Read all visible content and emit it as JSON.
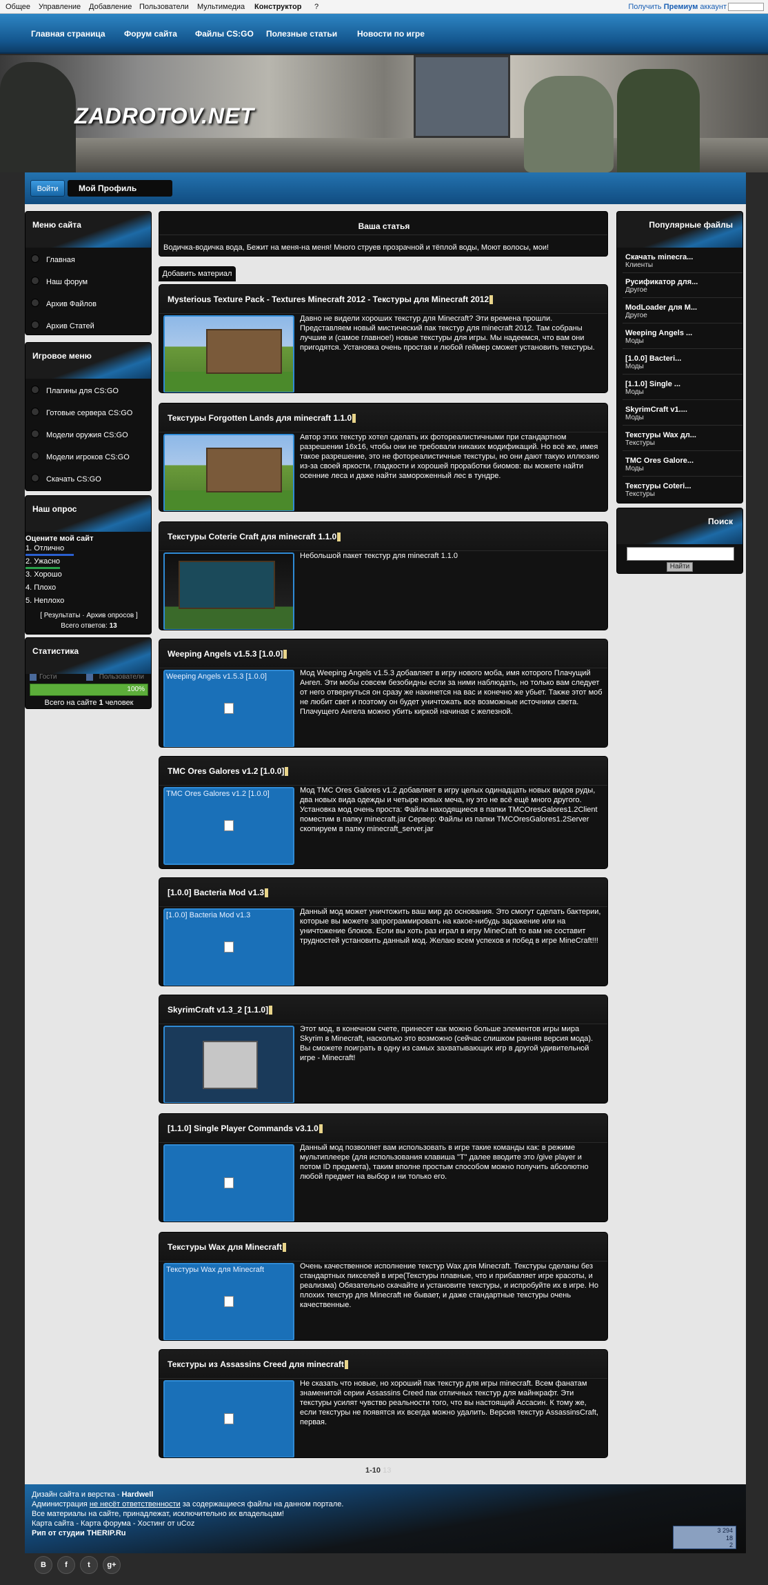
{
  "topbar": {
    "items": [
      "Общее",
      "Управление",
      "Добавление",
      "Пользователи",
      "Мультимедиа",
      "Конструктор",
      "?"
    ],
    "right_prefix": "Получить",
    "right_bold": "Премиум",
    "right_suffix": "аккаунт"
  },
  "nav": [
    "Главная страница",
    "Форум сайта",
    "Файлы CS:GO",
    "Полезные статьи",
    "Новости по игре"
  ],
  "header": {
    "logo": "ZADROTOV.NET"
  },
  "login": {
    "enter": "Войти",
    "profile": "Мой Профиль"
  },
  "left": {
    "site_menu": {
      "title": "Меню сайта",
      "items": [
        "Главная",
        "Наш форум",
        "Архив Файлов",
        "Архив Статей"
      ]
    },
    "game_menu": {
      "title": "Игровое меню",
      "items": [
        "Плагины для CS:GO",
        "Готовые сервера CS:GO",
        "Модели оружия CS:GO",
        "Модели игроков CS:GO",
        "Скачать CS:GO"
      ]
    },
    "poll": {
      "title": "Наш опрос",
      "question": "Оцените мой сайт",
      "options": [
        "1. Отлично",
        "2. Ужасно",
        "3. Хорошо",
        "4. Плохо",
        "5. Неплохо"
      ],
      "links": "[ Результаты · Архив опросов ]",
      "total_label": "Всего ответов:",
      "total": "13"
    },
    "stats": {
      "title": "Статистика",
      "col1": "Гости",
      "col2": "Пользователи",
      "percent": "100%",
      "online_prefix": "Всего на сайте",
      "online_count": "1",
      "online_suffix": "человек"
    }
  },
  "center": {
    "head_title": "Ваша статья",
    "head_text": "Водичка-водичка вода, Бежит на меня-на меня! Много струев прозрачной и тёплой воды, Моют волосы, мои!",
    "add_button": "Добавить материал",
    "articles": [
      {
        "title": "Mysterious Texture Pack - Textures Minecraft 2012 - Текстуры для Minecraft 2012",
        "alt": "",
        "text": "Давно не видели хороших текстур для Minecraft? Эти времена прошли. Представляем новый мистический пак текстур для minecraft 2012. Там собраны лучшие и (самое главное!) новые текстуры для игры. Мы надеемся, что вам они пригодятся. Установка очень простая и любой геймер сможет установить текстуры."
      },
      {
        "title": "Текстуры Forgotten Lands для minecraft 1.1.0",
        "alt": "",
        "text": "Автор этих текстур хотел сделать их фотореалистичными при стандартном разрешении 16х16, чтобы они не требовали никаких модификаций. Но всё же, имея такое разрешение, это не фотореалистичные текстуры, но они дают такую иллюзию из-за своей яркости, гладкости и хорошей проработки биомов: вы можете найти осенние леса и даже найти замороженный лес в тундре."
      },
      {
        "title": "Текстуры Coterie Craft для minecraft 1.1.0",
        "alt": "",
        "text": "Небольшой пакет текстур для minecraft 1.1.0"
      },
      {
        "title": "Weeping Angels v1.5.3 [1.0.0]",
        "alt": "Weeping Angels v1.5.3 [1.0.0]",
        "text": "Мод Weeping Angels v1.5.3 добавляет в игру нового моба, имя которого Плачущий Ангел. Эти мобы совсем безобидны если за ними наблюдать, но только вам следует от него отвернуться он сразу же накинется на вас и конечно же убьет. Также этот моб не любит свет и поэтому он будет уничтожать все возможные источники света. Плачущего Ангела можно убить киркой начиная с железной."
      },
      {
        "title": "TMC Ores Galores v1.2 [1.0.0]",
        "alt": "TMC Ores Galores v1.2 [1.0.0]",
        "text": "Мод TMC Ores Galores v1.2 добавляет в игру целых одинадцать новых видов руды, два новых вида одежды и четыре новых меча, ну это не всё ещё много другого. Установка мод очень проста: Файлы находящиеся в папки TMCOresGalores1.2Client поместим в папку minecraft.jar Сервер: Файлы из папки TMCOresGalores1.2Server скопируем в папку minecraft_server.jar"
      },
      {
        "title": "[1.0.0] Bacteria Mod v1.3",
        "alt": "[1.0.0] Bacteria Mod v1.3",
        "text": "Данный мод может уничтожить ваш мир до основания. Это смогут сделать бактерии, которые вы можете запрограммировать на какое-нибудь заражение или на уничтожение блоков. Если вы хоть раз играл в игру MineCraft то вам не составит трудностей установить данный мод. Желаю всем успехов и побед в игре MineCraft!!!"
      },
      {
        "title": "SkyrimCraft v1.3_2 [1.1.0]",
        "alt": "",
        "text": "Этот мод, в конечном счете, принесет как можно больше элементов игры мира Skyrim в Minecraft, насколько это возможно (сейчас слишком ранняя версия мода). Вы сможете поиграть в одну из самых захватывающих игр в другой удивительной игре - Minecraft!"
      },
      {
        "title": "[1.1.0] Single Player Commands v3.1.0",
        "alt": "",
        "text": "Данный мод позволяет вам использовать в игре такие команды как: в режиме мультиплеере (для использования клавиша \"T\" далее вводите это /give player и потом ID предмета), таким вполне простым способом можно получить абсолютно любой предмет на выбор и ни только его."
      },
      {
        "title": "Текстуры Wax для Minecraft",
        "alt": "Текстуры Wax для Minecraft",
        "text": "Очень качественное исполнение текстур Wax для Minecraft. Текстуры сделаны без стандартных пикселей в игре(Текстуры плавные, что и прибавляет игре красоты, и реализма) Обязательно скачайте и установите текстуры, и испробуйте их в игре. Но плохих текстур для Minecraft не бывает, и даже стандартные текстуры очень качественные."
      },
      {
        "title": "Текстуры из Assassins Creed для minecraft",
        "alt": "",
        "text": "Не сказать что новые, но хороший пак текстур для игры minecraft. Всем фанатам знаменитой серии Assassins Creed пак отличных текстур для майнкрафт. Эти текстуры усилят чувство реальности того, что вы настоящий Ассасин. К тому же, если текстуры не появятся их всегда можно удалить. Версия текстур AssassinsCraft, первая."
      }
    ],
    "pager": "1-10",
    "pager_rest": "13"
  },
  "right": {
    "popular": {
      "title": "Популярные файлы",
      "items": [
        {
          "t": "Скачать minecra...",
          "c": "Клиенты"
        },
        {
          "t": "Русификатор для...",
          "c": "Другое"
        },
        {
          "t": "ModLoader для M...",
          "c": "Другое"
        },
        {
          "t": "Weeping Angels ...",
          "c": "Моды"
        },
        {
          "t": "[1.0.0] Bacteri...",
          "c": "Моды"
        },
        {
          "t": "[1.1.0] Single ...",
          "c": "Моды"
        },
        {
          "t": "SkyrimCraft v1....",
          "c": "Моды"
        },
        {
          "t": "Текстуры Wax дл...",
          "c": "Текстуры"
        },
        {
          "t": "TMC Ores Galore...",
          "c": "Моды"
        },
        {
          "t": "Текстуры Coteri...",
          "c": "Текстуры"
        }
      ]
    },
    "search": {
      "title": "Поиск",
      "button": "Найти",
      "placeholder": ""
    }
  },
  "footer": {
    "line1_a": "Дизайн сайта и верстка -",
    "line1_b": "Hardwell",
    "line2_a": "Администрация",
    "line2_b": "не несёт ответственности",
    "line2_c": "за содержащиеся файлы на данном портале.",
    "line3": "Все материалы на сайте, принадлежат, исключительно их владельцам!",
    "line4": "Карта сайта - Карта форума - Хостинг от uCoz",
    "line5": "Рип от студии THERIP.Ru",
    "counter": {
      "v1": "3 294",
      "v2": "18",
      "v3": "2"
    },
    "social": [
      "В",
      "f",
      "t",
      "g+"
    ]
  }
}
